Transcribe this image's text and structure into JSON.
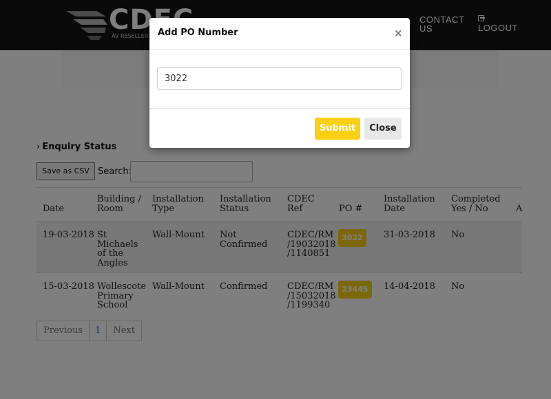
{
  "header": {
    "logo_text": "CDEC",
    "logo_tagline": "AV RESELLER /",
    "nav_contact": "CONTACT US",
    "nav_logout": "LOGOUT"
  },
  "enquiry": {
    "title": "Enquiry Status",
    "csv_button": "Save as CSV",
    "search_label": "Search:",
    "search_value": "",
    "columns": [
      "Date",
      "Building / Room",
      "Installation Type",
      "Installation Status",
      "CDEC Ref",
      "PO #",
      "Installation Date",
      "Completed Yes / No",
      "A"
    ],
    "rows": [
      {
        "date": "19-03-2018",
        "building": "St Michaels of the Angles",
        "type": "Wall-Mount",
        "status": "Not Confirmed",
        "ref": "CDEC/RM /19032018 /1140851",
        "po": "3022",
        "install_date": "31-03-2018",
        "completed": "No"
      },
      {
        "date": "15-03-2018",
        "building": "Wollescote Primary School",
        "type": "Wall-Mount",
        "status": "Confirmed",
        "ref": "CDEC/RM /15032018 /1199340",
        "po": "23445",
        "install_date": "14-04-2018",
        "completed": "No"
      }
    ],
    "pager": {
      "prev": "Previous",
      "page": "1",
      "next": "Next"
    }
  },
  "modal": {
    "title": "Add PO Number",
    "close_x": "×",
    "input_value": "3022",
    "submit_label": "Submit",
    "close_label": "Close"
  },
  "colors": {
    "accent_yellow": "#fbd012",
    "header_bg": "#151515",
    "overlay": "rgba(0,0,0,0.5)"
  }
}
